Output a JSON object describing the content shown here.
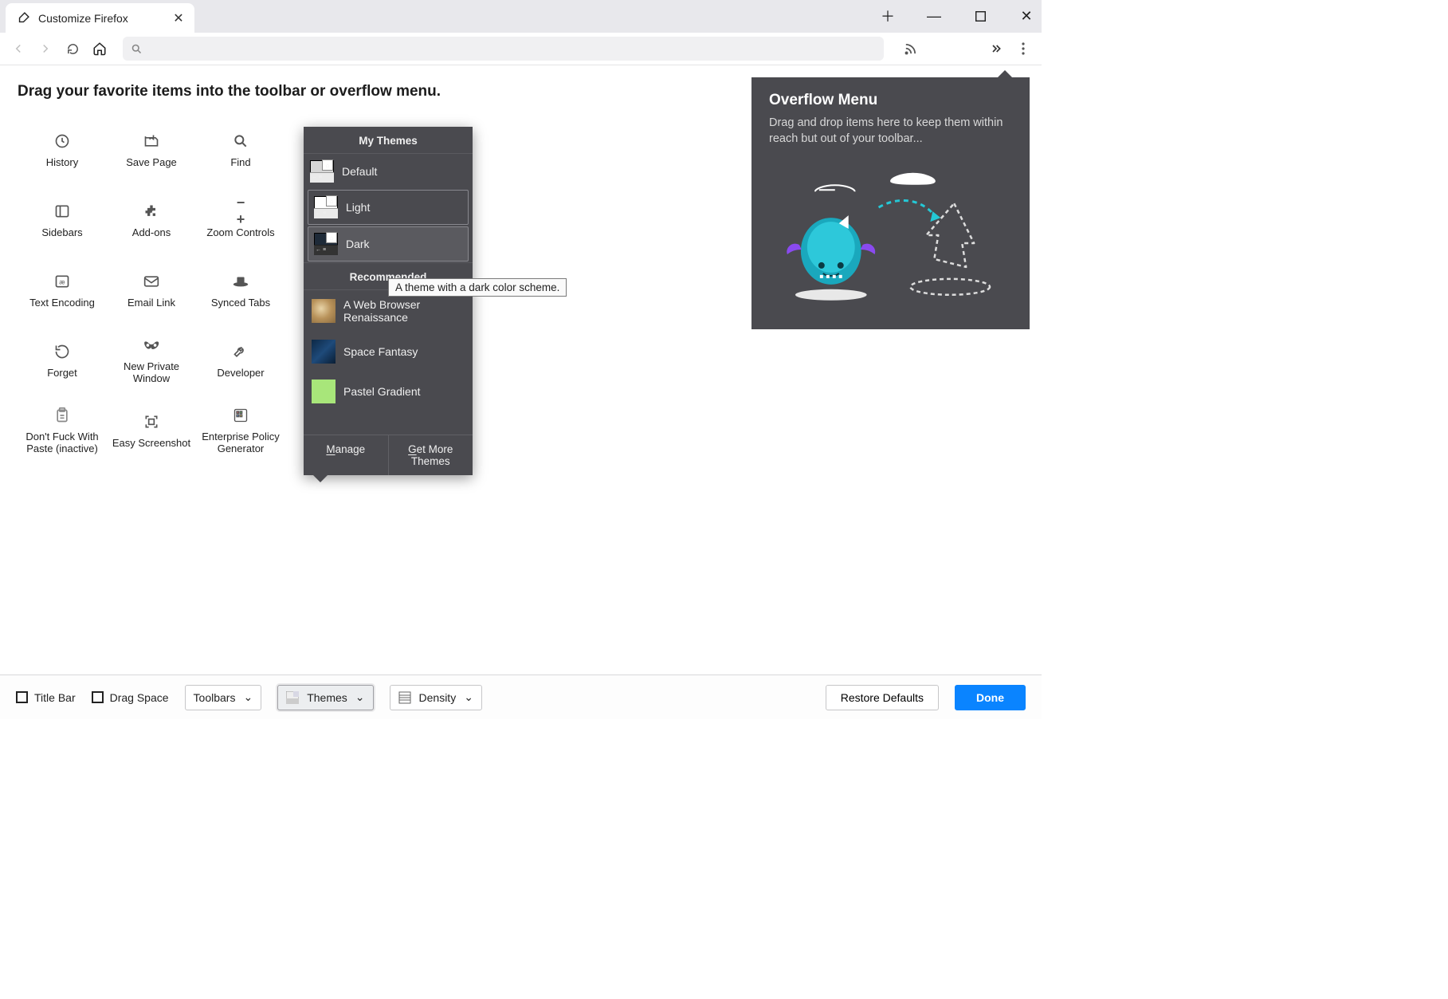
{
  "tab": {
    "title": "Customize Firefox"
  },
  "heading": "Drag your favorite items into the toolbar or overflow menu.",
  "items": [
    {
      "label": "History",
      "icon": "history-icon"
    },
    {
      "label": "Save Page",
      "icon": "save-page-icon"
    },
    {
      "label": "Find",
      "icon": "find-icon"
    },
    {
      "label": "Sidebars",
      "icon": "sidebars-icon"
    },
    {
      "label": "Add-ons",
      "icon": "addons-icon"
    },
    {
      "label": "Zoom Controls",
      "icon": "zoom-icon"
    },
    {
      "label": "Text Encoding",
      "icon": "textencoding-icon"
    },
    {
      "label": "Email Link",
      "icon": "email-icon"
    },
    {
      "label": "Synced Tabs",
      "icon": "syncedtabs-icon"
    },
    {
      "label": "Forget",
      "icon": "forget-icon"
    },
    {
      "label": "New Private Window",
      "icon": "private-icon"
    },
    {
      "label": "Developer",
      "icon": "developer-icon"
    },
    {
      "label": "Don't Fuck With Paste (inactive)",
      "icon": "paste-ext-icon"
    },
    {
      "label": "Easy Screenshot",
      "icon": "screenshot-icon"
    },
    {
      "label": "Enterprise Policy Generator",
      "icon": "policy-ext-icon"
    }
  ],
  "overflow": {
    "title": "Overflow Menu",
    "desc": "Drag and drop items here to keep them within reach but out of your toolbar..."
  },
  "themes": {
    "header": "My Themes",
    "list": [
      {
        "label": "Default",
        "kind": "default"
      },
      {
        "label": "Light",
        "kind": "light",
        "selected": true
      },
      {
        "label": "Dark",
        "kind": "dark",
        "hover": true
      }
    ],
    "recommended_header": "Recommended",
    "recommended": [
      {
        "label": "A Web Browser Renaissance",
        "swatch": "#c9a97a"
      },
      {
        "label": "Space Fantasy",
        "swatch": "#1e3a5f"
      },
      {
        "label": "Pastel Gradient",
        "swatch": "#a8e67a"
      }
    ],
    "manage": "Manage",
    "getmore": "Get More Themes"
  },
  "tooltip": "A theme with a dark color scheme.",
  "bottombar": {
    "titlebar": "Title Bar",
    "dragspace": "Drag Space",
    "toolbars": "Toolbars",
    "themes": "Themes",
    "density": "Density",
    "restore": "Restore Defaults",
    "done": "Done"
  }
}
